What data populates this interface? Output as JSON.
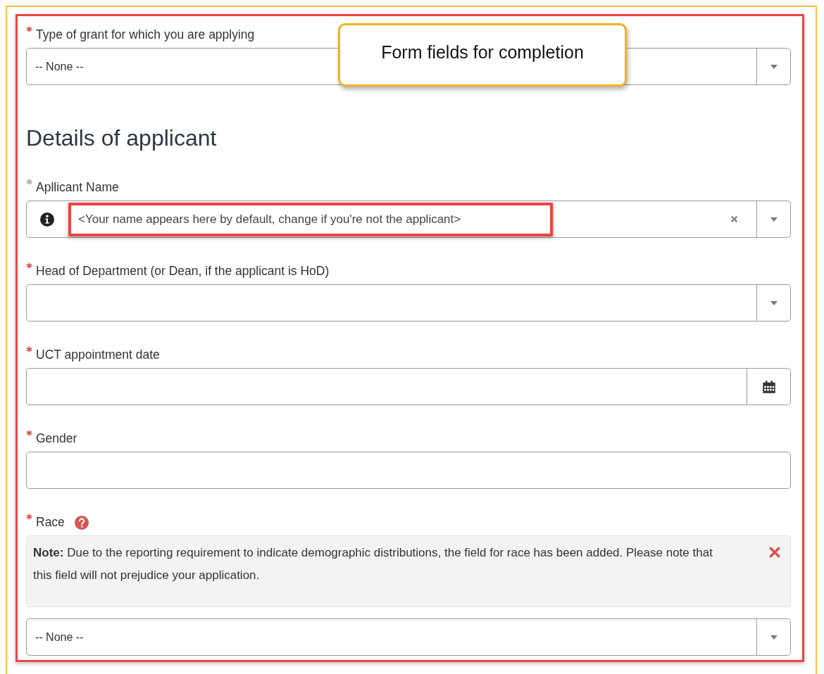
{
  "callout": {
    "text": "Form fields for completion"
  },
  "items": [
    {
      "kind": "select",
      "label": "Type of grant for which you are applying",
      "required": true,
      "required_filled": false,
      "value": "-- None --"
    },
    {
      "kind": "heading",
      "text": "Details of applicant"
    },
    {
      "kind": "lookup",
      "label": "Apllicant Name",
      "required": true,
      "required_filled": true,
      "placeholder": "<Your name appears here by default, change if you're not the applicant>",
      "highlighted": true
    },
    {
      "kind": "select",
      "label": "Head of Department (or Dean, if the applicant is HoD)",
      "required": true,
      "required_filled": false
    },
    {
      "kind": "date",
      "label": "UCT appointment date",
      "required": true,
      "required_filled": false
    },
    {
      "kind": "text",
      "label": "Gender",
      "required": true,
      "required_filled": false
    },
    {
      "kind": "select",
      "label": "Race",
      "required": true,
      "required_filled": false,
      "help": true,
      "note": {
        "label": "Note:",
        "text": "Due to the reporting requirement to indicate demographic distributions, the field for race has been added. Please note that this field will not prejudice your application.",
        "dismissible": true
      },
      "value": "-- None --"
    }
  ]
}
